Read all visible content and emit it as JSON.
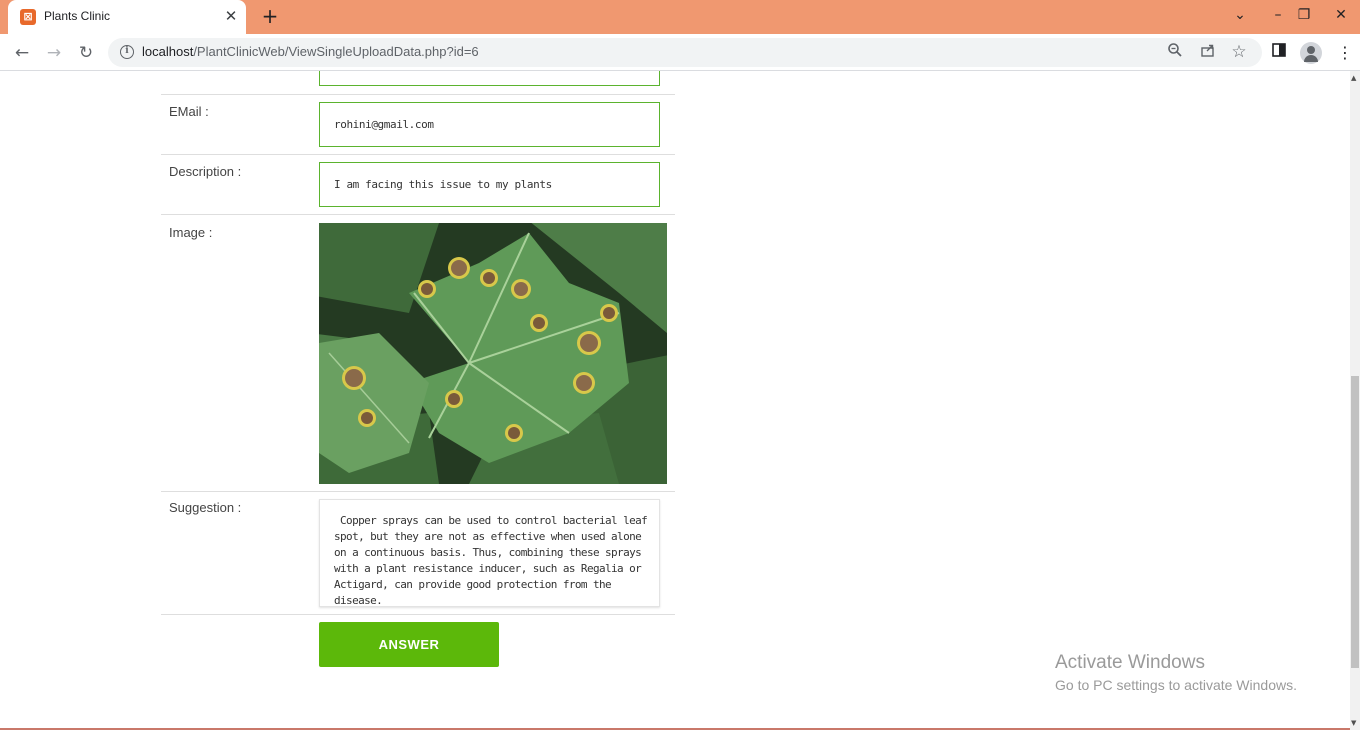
{
  "browser": {
    "tab_title": "Plants Clinic",
    "tab_close_glyph": "✕",
    "new_tab_glyph": "+",
    "url_host": "localhost",
    "url_path": "/PlantClinicWeb/ViewSingleUploadData.php?id=6",
    "window_controls": {
      "dropdown": "⌄",
      "minimize": "–",
      "restore": "❐",
      "close": "✕"
    },
    "nav": {
      "back": "←",
      "forward": "→",
      "reload": "↻"
    },
    "icons": {
      "zoom": "zoom-icon",
      "share": "share-icon",
      "bookmark": "☆",
      "sidepanel": "side-panel-icon",
      "menu": "⋮"
    }
  },
  "form": {
    "email_label": "EMail :",
    "email_value": "rohini@gmail.com",
    "description_label": "Description :",
    "description_value": "I am facing this issue to my plants",
    "image_label": "Image :",
    "suggestion_label": "Suggestion :",
    "suggestion_value": " Copper sprays can be used to control bacterial leaf spot, but they are not as effective when used alone on a continuous basis. Thus, combining these sprays with a plant resistance inducer, such as Regalia or Actigard, can provide good protection from the disease.",
    "answer_button": "ANSWER"
  },
  "watermark": {
    "title": "Activate Windows",
    "subtitle": "Go to PC settings to activate Windows."
  },
  "colors": {
    "tabbar": "#f09870",
    "field_border": "#5bb32e",
    "answer_button": "#5cb80a"
  }
}
